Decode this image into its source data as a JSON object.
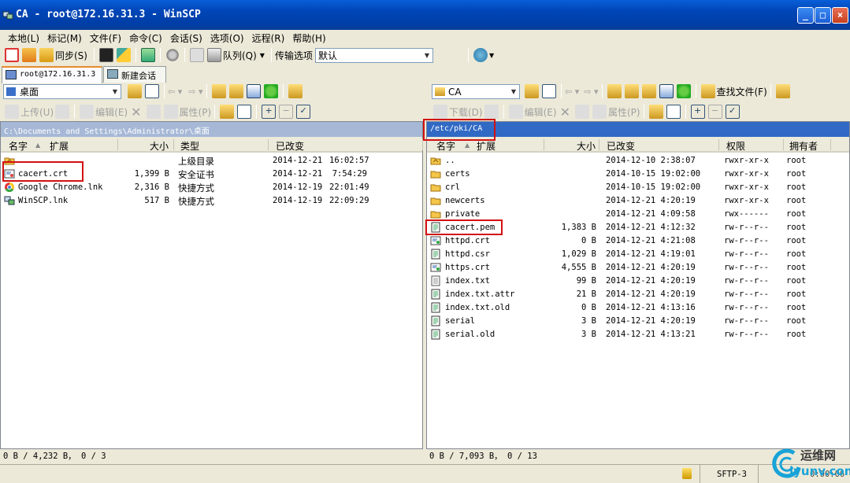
{
  "window": {
    "title": "CA - root@172.16.31.3 - WinSCP"
  },
  "menu": [
    "本地(L)",
    "标记(M)",
    "文件(F)",
    "命令(C)",
    "会话(S)",
    "选项(O)",
    "远程(R)",
    "帮助(H)"
  ],
  "toolbar": {
    "sync_label": "同步(S)",
    "queue_label": "队列(Q)",
    "transfer_label": "传输选项",
    "transfer_value": "默认"
  },
  "tabs": [
    {
      "label": "root@172.16.31.3",
      "active": true
    },
    {
      "label": "新建会话",
      "active": false
    }
  ],
  "local": {
    "drive": "桌面",
    "upload_label": "上传(U)",
    "edit_label": "编辑(E)",
    "props_label": "属性(P)",
    "path": "C:\\Documents and Settings\\Administrator\\桌面",
    "columns": [
      "名字",
      "扩展",
      "大小",
      "类型",
      "已改变"
    ],
    "files": [
      {
        "name": "",
        "size": "",
        "type": "上级目录",
        "date": "2014-12-21",
        "time": "16:02:57",
        "icon": "parent-folder-icon"
      },
      {
        "name": "cacert.crt",
        "size": "1,399 B",
        "type": "安全证书",
        "date": "2014-12-21",
        "time": "7:54:29",
        "icon": "certificate-icon"
      },
      {
        "name": "Google Chrome.lnk",
        "size": "2,316 B",
        "type": "快捷方式",
        "date": "2014-12-19",
        "time": "22:01:49",
        "icon": "chrome-icon"
      },
      {
        "name": "WinSCP.lnk",
        "size": "517 B",
        "type": "快捷方式",
        "date": "2014-12-19",
        "time": "22:09:29",
        "icon": "winscp-icon"
      }
    ],
    "status": "0 B / 4,232 B，  0 / 3"
  },
  "remote": {
    "drive": "CA",
    "download_label": "下载(D)",
    "edit_label": "编辑(E)",
    "props_label": "属性(P)",
    "find_label": "查找文件(F)",
    "path": "/etc/pki/CA",
    "columns": [
      "名字",
      "扩展",
      "大小",
      "已改变",
      "权限",
      "拥有者"
    ],
    "files": [
      {
        "name": "..",
        "size": "",
        "changed": "2014-12-10 2:38:07",
        "rights": "rwxr-xr-x",
        "owner": "root",
        "icon": "parent-folder-icon"
      },
      {
        "name": "certs",
        "size": "",
        "changed": "2014-10-15 19:02:00",
        "rights": "rwxr-xr-x",
        "owner": "root",
        "icon": "folder-icon"
      },
      {
        "name": "crl",
        "size": "",
        "changed": "2014-10-15 19:02:00",
        "rights": "rwxr-xr-x",
        "owner": "root",
        "icon": "folder-icon"
      },
      {
        "name": "newcerts",
        "size": "",
        "changed": "2014-12-21 4:20:19",
        "rights": "rwxr-xr-x",
        "owner": "root",
        "icon": "folder-icon"
      },
      {
        "name": "private",
        "size": "",
        "changed": "2014-12-21 4:09:58",
        "rights": "rwx------",
        "owner": "root",
        "icon": "folder-icon"
      },
      {
        "name": "cacert.pem",
        "size": "1,383 B",
        "changed": "2014-12-21 4:12:32",
        "rights": "rw-r--r--",
        "owner": "root",
        "icon": "file-icon"
      },
      {
        "name": "httpd.crt",
        "size": "0 B",
        "changed": "2014-12-21 4:21:08",
        "rights": "rw-r--r--",
        "owner": "root",
        "icon": "certificate-icon"
      },
      {
        "name": "httpd.csr",
        "size": "1,029 B",
        "changed": "2014-12-21 4:19:01",
        "rights": "rw-r--r--",
        "owner": "root",
        "icon": "file-icon"
      },
      {
        "name": "https.crt",
        "size": "4,555 B",
        "changed": "2014-12-21 4:20:19",
        "rights": "rw-r--r--",
        "owner": "root",
        "icon": "certificate-icon"
      },
      {
        "name": "index.txt",
        "size": "99 B",
        "changed": "2014-12-21 4:20:19",
        "rights": "rw-r--r--",
        "owner": "root",
        "icon": "text-file-icon"
      },
      {
        "name": "index.txt.attr",
        "size": "21 B",
        "changed": "2014-12-21 4:20:19",
        "rights": "rw-r--r--",
        "owner": "root",
        "icon": "file-icon"
      },
      {
        "name": "index.txt.old",
        "size": "0 B",
        "changed": "2014-12-21 4:13:16",
        "rights": "rw-r--r--",
        "owner": "root",
        "icon": "file-icon"
      },
      {
        "name": "serial",
        "size": "3 B",
        "changed": "2014-12-21 4:20:19",
        "rights": "rw-r--r--",
        "owner": "root",
        "icon": "file-icon"
      },
      {
        "name": "serial.old",
        "size": "3 B",
        "changed": "2014-12-21 4:13:21",
        "rights": "rw-r--r--",
        "owner": "root",
        "icon": "file-icon"
      }
    ],
    "status": "0 B / 7,093 B，  0 / 13"
  },
  "statusbar": {
    "protocol": "SFTP-3",
    "timer": "0:00:06"
  },
  "watermark": {
    "cn": "运维网",
    "url": "iyunv.com"
  },
  "colors": {
    "title_bar": "#0046b8",
    "active_path": "#316ac5",
    "highlight_box": "#d31010"
  }
}
